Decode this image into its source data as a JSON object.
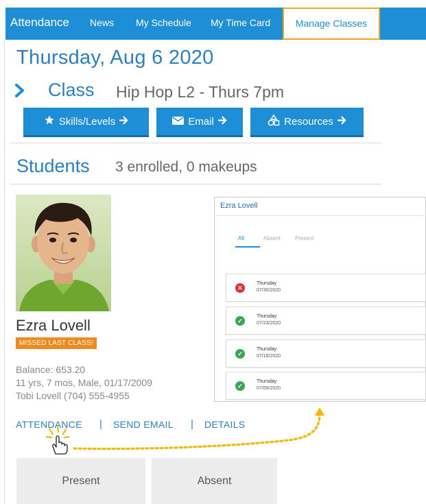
{
  "nav": {
    "brand": "Attendance",
    "items": [
      "News",
      "My Schedule",
      "My Time Card"
    ],
    "active": "Manage Classes"
  },
  "header": {
    "date": "Thursday, Aug 6 2020",
    "class_label": "Class",
    "class_name": "Hip Hop L2 - Thurs 7pm"
  },
  "buttons": {
    "skills": "Skills/Levels",
    "email": "Email",
    "resources": "Resources"
  },
  "students": {
    "title": "Students",
    "count": "3 enrolled, 0 makeups"
  },
  "student": {
    "name": "Ezra Lovell",
    "badge": "MISSED LAST CLASS!",
    "balance": "Balance: 653.20",
    "details": "11 yrs, 7 mos, Male, 01/17/2009",
    "contact": "Tobi Lovell (704) 555-4955"
  },
  "links": {
    "attendance": "ATTENDANCE",
    "send_email": "SEND EMAIL",
    "details": "DETAILS",
    "separator": "|"
  },
  "attendance_buttons": {
    "present": "Present",
    "absent": "Absent"
  },
  "popup": {
    "name": "Ezra Lovell",
    "tabs": [
      "All",
      "Absent",
      "Present"
    ],
    "records": [
      {
        "day": "Thursday",
        "date": "07/30/2020",
        "status": "absent"
      },
      {
        "day": "Thursday",
        "date": "07/23/2020",
        "status": "present"
      },
      {
        "day": "Thursday",
        "date": "07/16/2020",
        "status": "present"
      },
      {
        "day": "Thursday",
        "date": "07/09/2020",
        "status": "present"
      }
    ]
  },
  "colors": {
    "primary": "#1e8fd6",
    "heading": "#2a7fc6",
    "highlight": "#f0a61a",
    "badge": "#f0891e",
    "absent": "#e2312f",
    "present": "#39a854"
  }
}
